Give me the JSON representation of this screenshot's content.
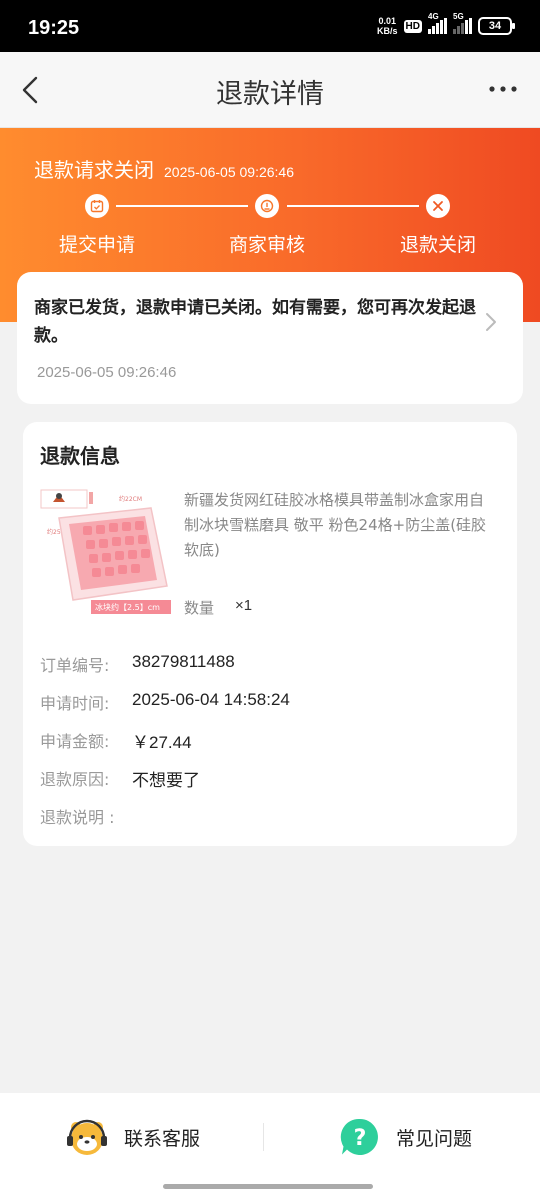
{
  "status_bar": {
    "time": "19:25",
    "net_speed_value": "0.01",
    "net_speed_unit": "KB/s",
    "hd_label": "HD",
    "signal1_label": "4G",
    "signal2_label": "5G",
    "battery": "34"
  },
  "header": {
    "title": "退款详情"
  },
  "banner": {
    "status_text": "退款请求关闭",
    "status_time": "2025-06-05 09:26:46",
    "steps": [
      {
        "label": "提交申请"
      },
      {
        "label": "商家审核"
      },
      {
        "label": "退款关闭"
      }
    ]
  },
  "notice": {
    "message": "商家已发货，退款申请已关闭。如有需要，您可再次发起退款。",
    "time": "2025-06-05 09:26:46"
  },
  "refund_info": {
    "title": "退款信息",
    "product": {
      "name": "新疆发货网红硅胶冰格模具带盖制冰盒家用自制冰块雪糕磨具 敬平 粉色24格+防尘盖(硅胶软底)",
      "qty_label": "数量",
      "qty_value": "×1",
      "image_caption": "冰块约【2.5】cm",
      "image_dim_top": "约22CM",
      "image_dim_side": "约25CM"
    },
    "rows": [
      {
        "key": "订单编号:",
        "value": "38279811488"
      },
      {
        "key": "申请时间:",
        "value": "2025-06-04 14:58:24"
      },
      {
        "key": "申请金额:",
        "value": "￥27.44"
      },
      {
        "key": "退款原因:",
        "value": "不想要了"
      },
      {
        "key": "退款说明 :",
        "value": ""
      }
    ]
  },
  "bottom_bar": {
    "service_label": "联系客服",
    "faq_label": "常见问题"
  },
  "colors": {
    "banner_start": "#ff8c2e",
    "banner_end": "#ef4a22",
    "faq_icon": "#2ecf9b"
  }
}
